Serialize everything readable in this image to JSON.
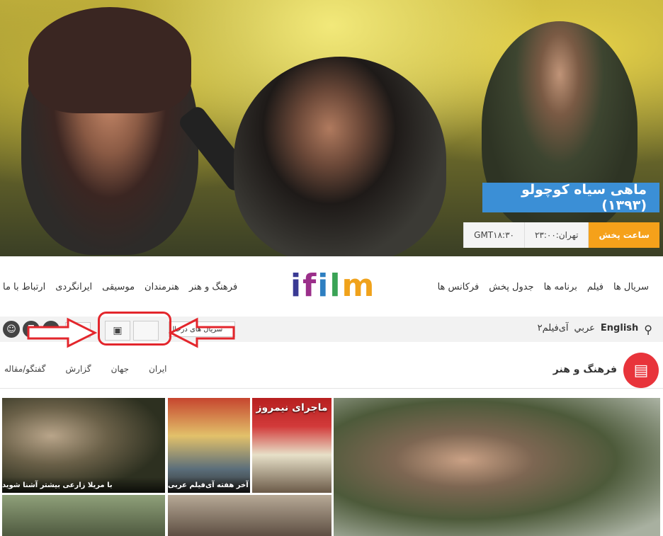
{
  "hero": {
    "title": "ماهی سیاه کوچولو (۱۳۹۳)",
    "schedule_label": "ساعت پخش",
    "tehran_time": "تهران:۲۳:۰۰",
    "gmt_time": "GMT۱۸:۳۰"
  },
  "nav": {
    "right_items": [
      "سریال ها",
      "فیلم",
      "برنامه ها",
      "جدول پخش",
      "فرکانس ها"
    ],
    "left_items": [
      "فرهنگ و هنر",
      "هنرمندان",
      "موسيقى",
      "ایرانگردی",
      "ارتباط با ما"
    ],
    "logo": [
      "i",
      "f",
      "i",
      "l",
      "m"
    ]
  },
  "toolbar": {
    "languages": [
      "English",
      "عربي",
      "آی‌فیلم۲"
    ],
    "series_dropdown": "سریال های درحال",
    "close": "×",
    "apple_icon": "",
    "android_icon": "▣"
  },
  "section": {
    "title": "فرهنگ و هنر",
    "tabs": [
      "ایران",
      "جهان",
      "گزارش",
      "گفتگو/مقاله"
    ]
  },
  "tiles": {
    "t1_caption": "با مریلا زارعی بیشتر آشنا شوید",
    "t2_caption": "فیلم‌های آخر هفته آی‌فیلم عربی",
    "t3_poster": "ماجرای نیمروز"
  },
  "colors": {
    "accent_blue": "#3b8fd6",
    "accent_orange": "#f5a11a",
    "section_red": "#e8343b",
    "annotation_red": "#e3262c"
  }
}
